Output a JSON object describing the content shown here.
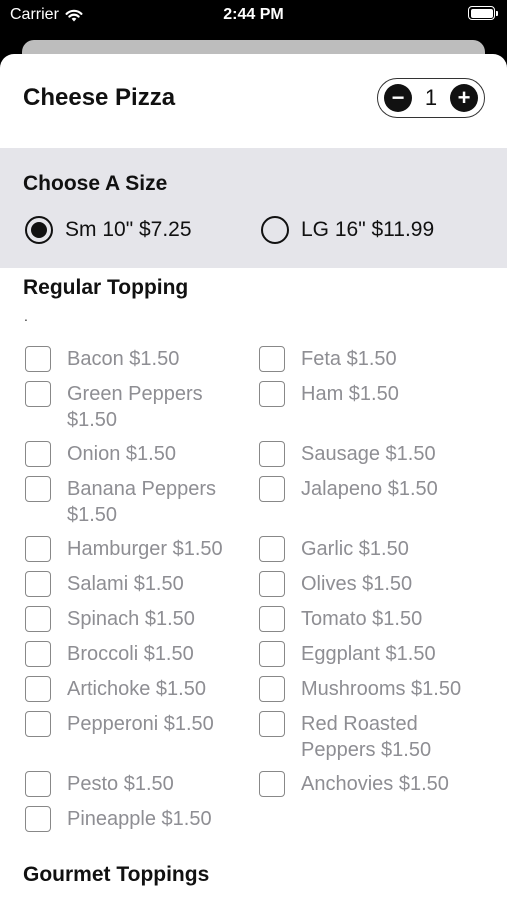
{
  "status_bar": {
    "carrier": "Carrier",
    "time": "2:44 PM"
  },
  "header": {
    "title": "Cheese Pizza",
    "quantity": "1",
    "minus": "−",
    "plus": "+"
  },
  "size": {
    "heading": "Choose A Size",
    "options": [
      {
        "label": "Sm 10\" $7.25",
        "selected": true
      },
      {
        "label": "LG 16\" $11.99",
        "selected": false
      }
    ]
  },
  "regular": {
    "heading": "Regular Topping",
    "dot": ".",
    "left": [
      [
        "Bacon $1.50"
      ],
      [
        "Green Peppers",
        "$1.50"
      ],
      [
        "Onion $1.50"
      ],
      [
        "Banana Peppers",
        "$1.50"
      ],
      [
        "Hamburger $1.50"
      ],
      [
        "Salami $1.50"
      ],
      [
        "Spinach $1.50"
      ],
      [
        "Broccoli $1.50"
      ],
      [
        "Artichoke $1.50"
      ],
      [
        "Pepperoni $1.50"
      ],
      [
        "Pesto $1.50"
      ],
      [
        "Pineapple $1.50"
      ]
    ],
    "right": [
      [
        "Feta $1.50"
      ],
      [
        "Ham $1.50"
      ],
      [
        "Sausage $1.50"
      ],
      [
        "Jalapeno $1.50"
      ],
      [
        "Garlic $1.50"
      ],
      [
        "Olives $1.50"
      ],
      [
        "Tomato $1.50"
      ],
      [
        "Eggplant $1.50"
      ],
      [
        "Mushrooms $1.50"
      ],
      [
        "Red Roasted",
        "Peppers $1.50"
      ],
      [
        "Anchovies $1.50"
      ]
    ]
  },
  "gourmet": {
    "heading": "Gourmet Toppings"
  }
}
